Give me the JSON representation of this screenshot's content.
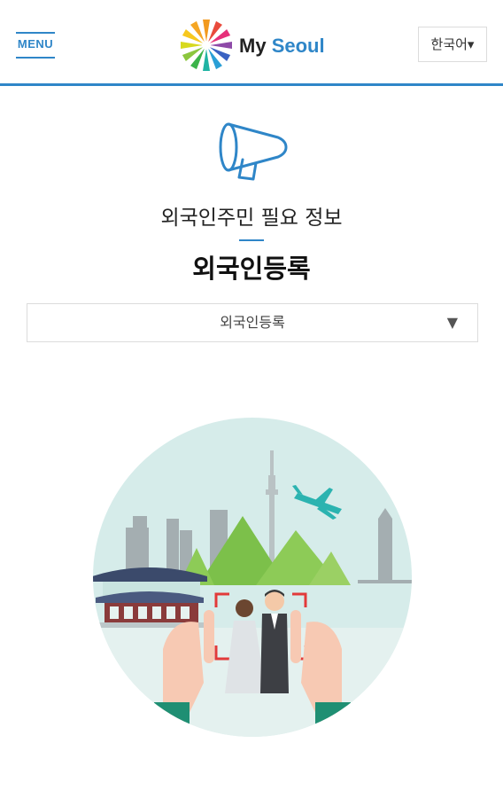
{
  "header": {
    "menu_label": "MENU",
    "brand_part1": "My",
    "brand_part2": "Seoul",
    "language_selector": "한국어▾"
  },
  "main": {
    "category": "외국인주민 필요 정보",
    "title": "외국인등록",
    "dropdown": {
      "selected": "외국인등록",
      "arrow": "▼"
    }
  },
  "icons": {
    "menu": "hamburger-menu-icon",
    "logo": "colorful-star-logo-icon",
    "page": "megaphone-icon",
    "illustration": "foreigner-registration-illustration"
  },
  "colors": {
    "accent": "#2f86c8",
    "illustration_bg": "#d6ecea",
    "mountain": "#7cc04a"
  }
}
